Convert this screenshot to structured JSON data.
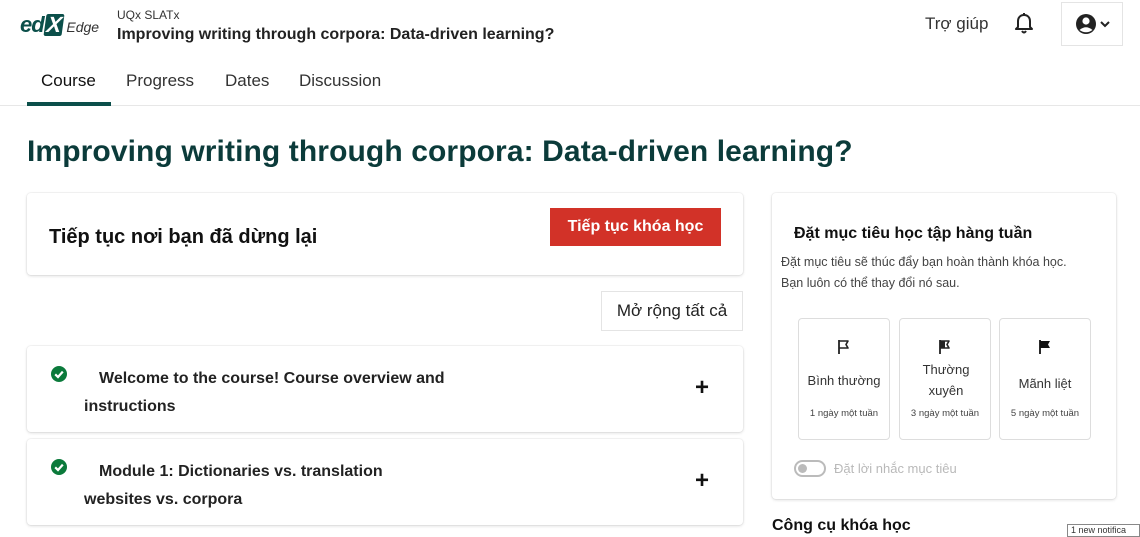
{
  "header": {
    "logo_text_1": "ed",
    "logo_text_2": "X",
    "logo_suffix": "Edge",
    "course_org": "UQx SLATx",
    "course_title": "Improving writing through corpora: Data-driven learning?",
    "help_label": "Trợ giúp",
    "icons": {
      "notifications": "bell-icon",
      "user": "user-circle-icon",
      "user_menu": "chevron-down-icon"
    }
  },
  "tabs": [
    {
      "label": "Course",
      "active": true
    },
    {
      "label": "Progress",
      "active": false
    },
    {
      "label": "Dates",
      "active": false
    },
    {
      "label": "Discussion",
      "active": false
    }
  ],
  "main": {
    "title": "Improving writing through corpora: Data-driven learning?",
    "resume": {
      "text": "Tiếp tục nơi bạn đã dừng lại",
      "button_label": "Tiếp tục khóa học"
    },
    "expand_all_label": "Mở rộng tất cả",
    "sections": [
      {
        "title": "Welcome to the course! Course overview and instructions",
        "completed": true
      },
      {
        "title": "Module 1: Dictionaries vs. translation websites vs. corpora",
        "completed": true
      }
    ]
  },
  "goal": {
    "title": "Đặt mục tiêu học tập hàng tuần",
    "description": "Đặt mục tiêu sẽ thúc đẩy bạn hoàn thành khóa học. Bạn luôn có thể thay đổi nó sau.",
    "options": [
      {
        "label": "Bình thường",
        "sub": "1 ngày một tuần",
        "icon": "flag-outline-icon"
      },
      {
        "label": "Thường xuyên",
        "sub": "3 ngày một tuần",
        "icon": "flag-half-icon"
      },
      {
        "label": "Mãnh liệt",
        "sub": "5 ngày một tuần",
        "icon": "flag-filled-icon"
      }
    ],
    "reminder_label": "Đặt lời nhắc mục tiêu",
    "reminder_enabled": false
  },
  "tools_heading": "Công cụ khóa học",
  "notification_popup": "1 new notifica",
  "colors": {
    "brand": "#0b4f4a",
    "title": "#0b3b3a",
    "resume_button": "#d23228",
    "complete_check": "#0b7a3b"
  }
}
